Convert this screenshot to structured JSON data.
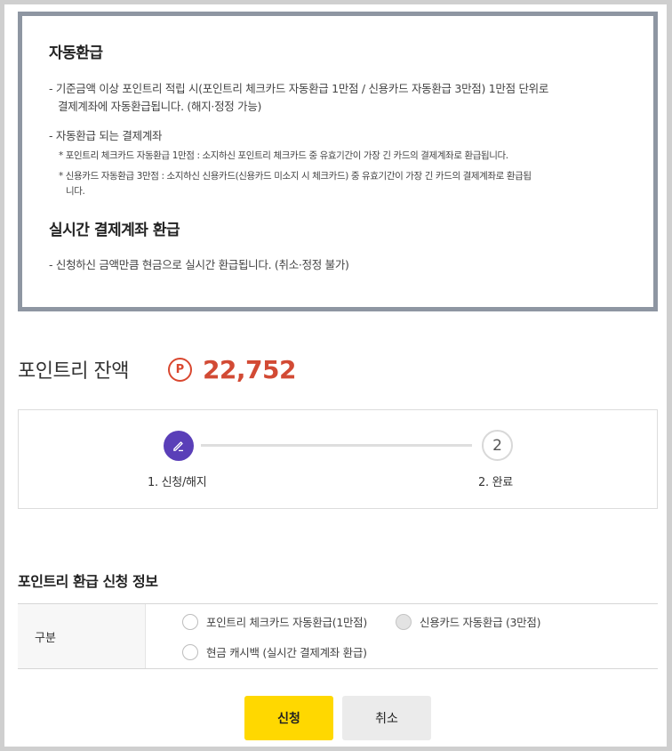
{
  "notice": {
    "auto_refund_title": "자동환급",
    "auto_refund_desc_1": "- 기준금액 이상 포인트리 적립 시(포인트리 체크카드 자동환급 1만점 / 신용카드 자동환급 3만점) 1만점 단위로",
    "auto_refund_desc_2": "결제계좌에 자동환급됩니다. (해지·정정 가능)",
    "account_heading": "- 자동환급 되는 결제계좌",
    "account_note_1": "* 포인트리 체크카드 자동환급 1만점 : 소지하신 포인트리 체크카드 중 유효기간이 가장 긴 카드의 결제계좌로 환급됩니다.",
    "account_note_2a": "* 신용카드 자동환급 3만점 : 소지하신 신용카드(신용카드 미소지 시 체크카드) 중 유효기간이 가장 긴 카드의 결제계좌로 환급됩",
    "account_note_2b": "니다.",
    "realtime_title": "실시간 결제계좌 환급",
    "realtime_desc": "- 신청하신 금액만큼 현금으로 실시간 환급됩니다. (취소·정정 불가)"
  },
  "balance": {
    "label": "포인트리 잔액",
    "point_symbol": "P",
    "amount": "22,752"
  },
  "steps": {
    "step1_label": "1. 신청/해지",
    "step2_number": "2",
    "step2_label": "2. 완료",
    "active_color": "#5a3fb8",
    "step1_icon": "pencil-icon"
  },
  "form": {
    "section_title": "포인트리 환급 신청 정보",
    "category_label": "구분",
    "options": [
      {
        "label": "포인트리 체크카드 자동환급(1만점)"
      },
      {
        "label": "신용카드 자동환급 (3만점)"
      },
      {
        "label": "현금 캐시백 (실시간 결제계좌 환급)"
      }
    ]
  },
  "buttons": {
    "submit": "신청",
    "cancel": "취소"
  },
  "colors": {
    "accent": "#ffd800",
    "amount": "#d24a34"
  }
}
